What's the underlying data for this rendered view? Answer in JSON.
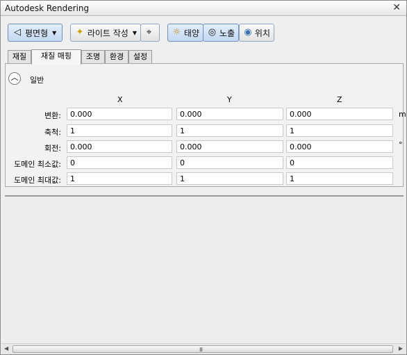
{
  "window": {
    "title": "Autodesk Rendering"
  },
  "toolbar": {
    "plane_label": "평면형",
    "light_label": "라이트 작성",
    "sun_label": "태양",
    "exposure_label": "노출",
    "location_label": "위치"
  },
  "tabs": [
    "재질",
    "재질 매핑",
    "조명",
    "환경",
    "설정"
  ],
  "section": {
    "title": "일반"
  },
  "columns": [
    "X",
    "Y",
    "Z"
  ],
  "rows": [
    {
      "label": "변환:",
      "x": "0.000",
      "y": "0.000",
      "z": "0.000",
      "unit": "m"
    },
    {
      "label": "축척:",
      "x": "1",
      "y": "1",
      "z": "1",
      "unit": ""
    },
    {
      "label": "회전:",
      "x": "0.000",
      "y": "0.000",
      "z": "0.000",
      "unit": "°"
    },
    {
      "label": "도메인 최소값:",
      "x": "0",
      "y": "0",
      "z": "0",
      "unit": ""
    },
    {
      "label": "도메인 최대값:",
      "x": "1",
      "y": "1",
      "z": "1",
      "unit": ""
    }
  ],
  "scrollbar": {
    "grip": "III"
  }
}
